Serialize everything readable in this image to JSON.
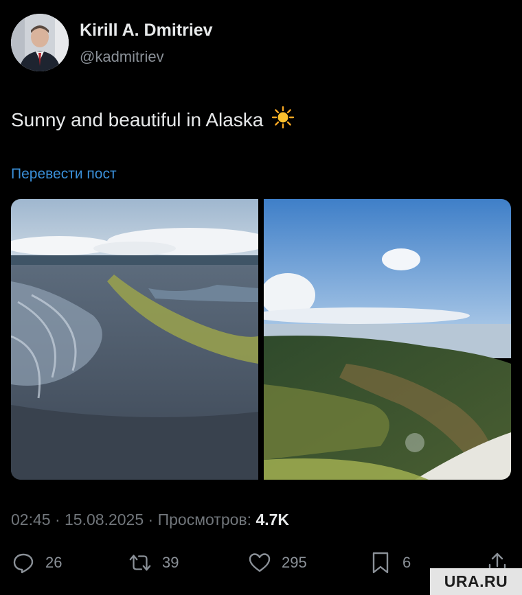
{
  "author": {
    "display_name": "Kirill A. Dmitriev",
    "handle": "@kadmitriev"
  },
  "post": {
    "text": "Sunny and beautiful in Alaska",
    "emoji_icon": "sun-icon",
    "translate_label": "Перевести пост",
    "images": [
      {
        "description_icon": "aerial-river-delta-photo"
      },
      {
        "description_icon": "aerial-forest-coast-photo"
      }
    ]
  },
  "meta": {
    "time": "02:45",
    "sep1": "·",
    "date": "15.08.2025",
    "sep2": "·",
    "views_label": "Просмотров:",
    "views_count": "4.7K"
  },
  "actions": {
    "reply_count": "26",
    "retweet_count": "39",
    "like_count": "295",
    "bookmark_count": "6"
  },
  "watermark": "URA.RU",
  "colors": {
    "background": "#000000",
    "link": "#3a8fd8",
    "muted": "#71767b"
  }
}
